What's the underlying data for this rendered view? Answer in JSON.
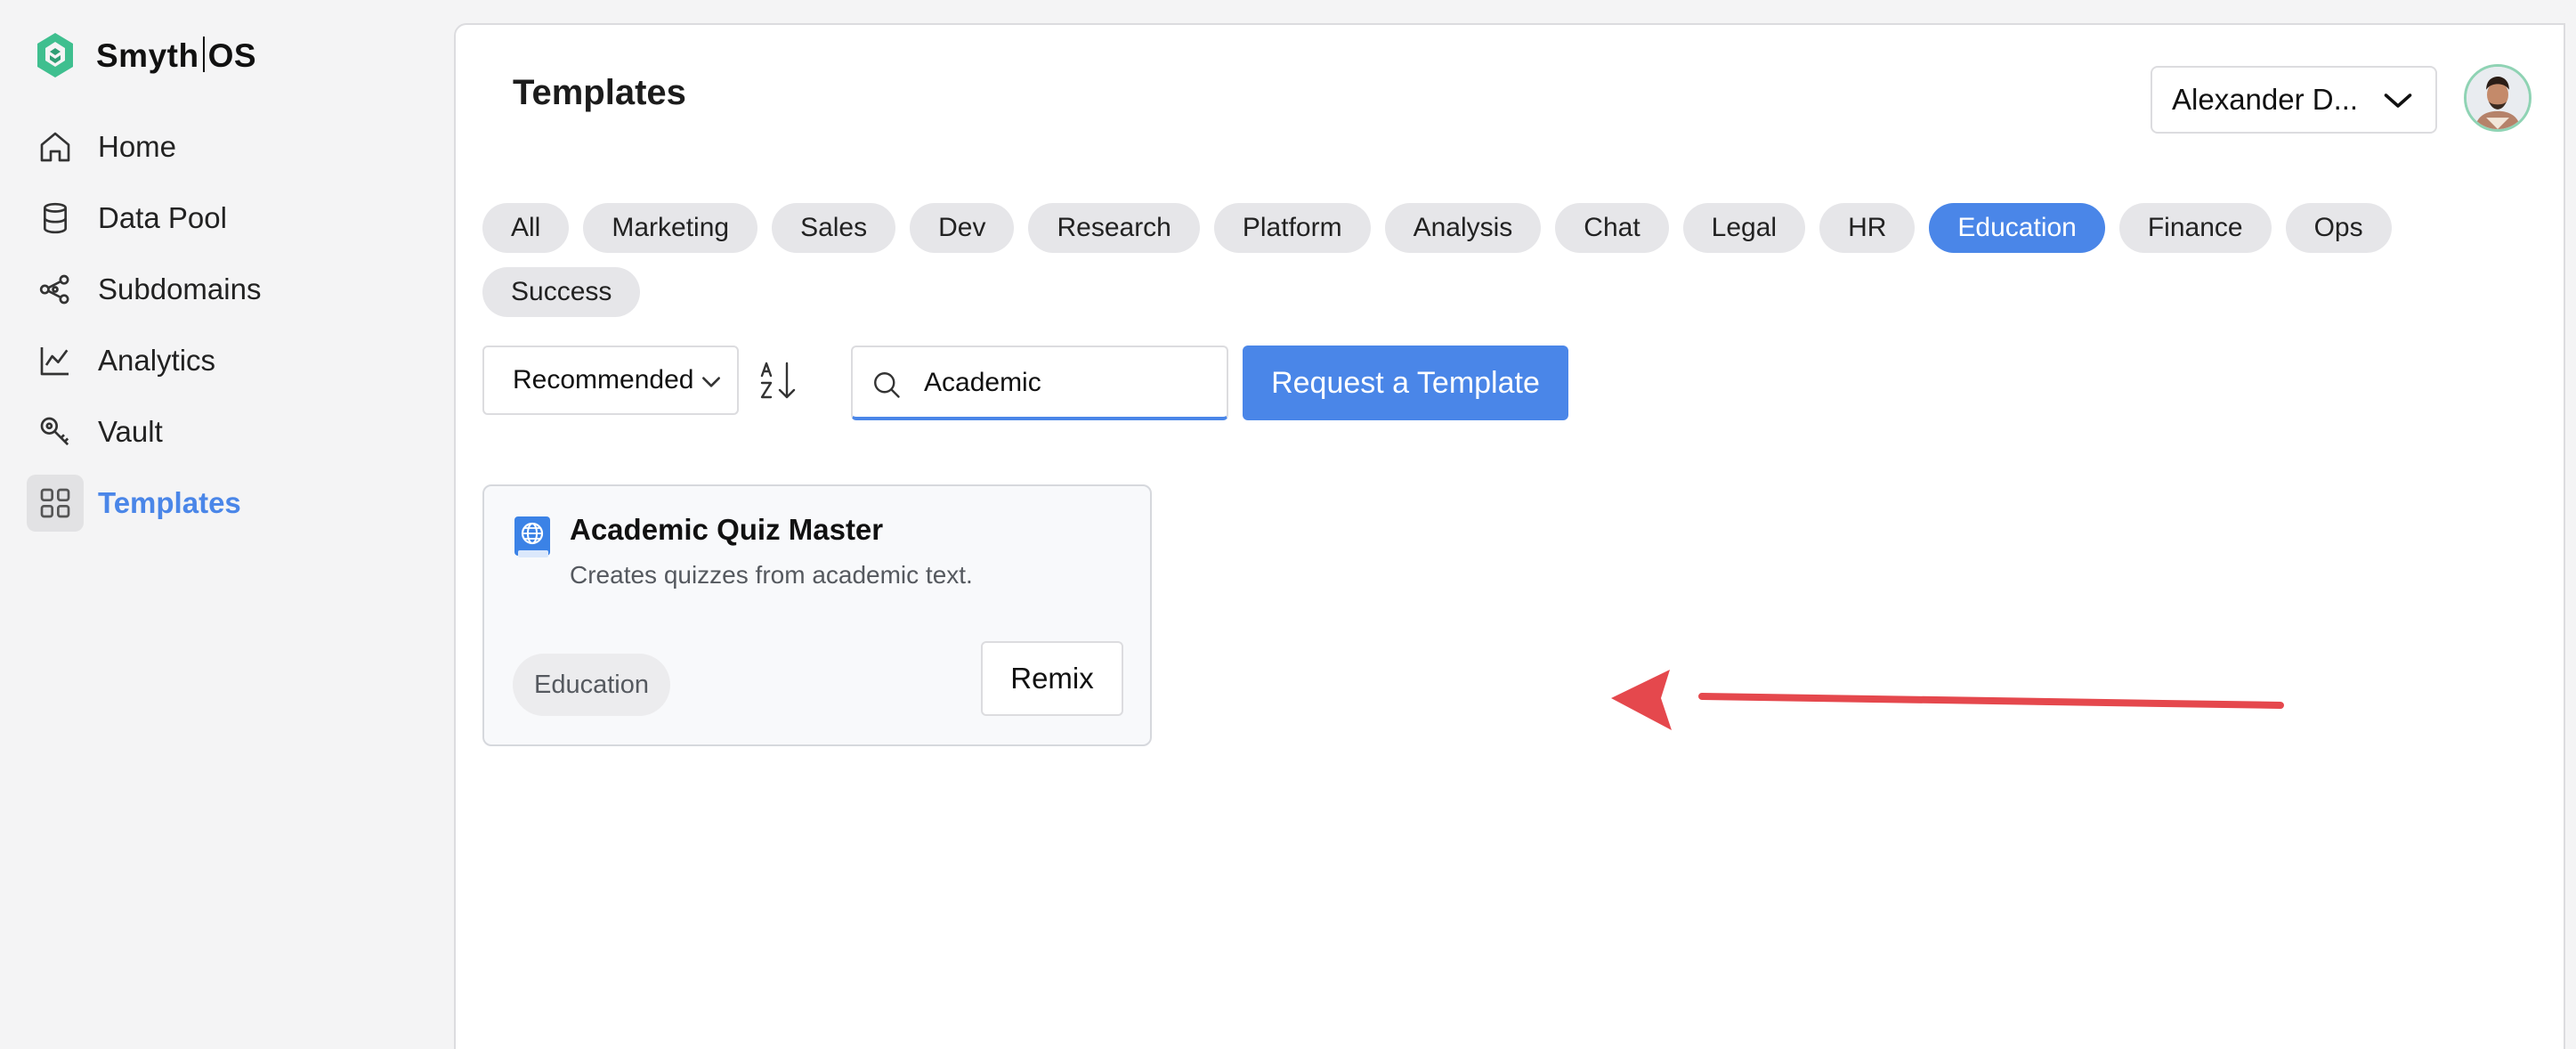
{
  "app": {
    "logo_left": "Smyth",
    "logo_right": "OS"
  },
  "sidebar": {
    "items": [
      {
        "label": "Home",
        "icon": "home-icon",
        "active": false
      },
      {
        "label": "Data Pool",
        "icon": "database-icon",
        "active": false
      },
      {
        "label": "Subdomains",
        "icon": "share-nodes-icon",
        "active": false
      },
      {
        "label": "Analytics",
        "icon": "chart-line-icon",
        "active": false
      },
      {
        "label": "Vault",
        "icon": "key-icon",
        "active": false
      },
      {
        "label": "Templates",
        "icon": "grid-icon",
        "active": true
      }
    ]
  },
  "header": {
    "title": "Templates",
    "user_name": "Alexander D...",
    "avatar_icon": "avatar"
  },
  "categories": [
    {
      "label": "All",
      "active": false
    },
    {
      "label": "Marketing",
      "active": false
    },
    {
      "label": "Sales",
      "active": false
    },
    {
      "label": "Dev",
      "active": false
    },
    {
      "label": "Research",
      "active": false
    },
    {
      "label": "Platform",
      "active": false
    },
    {
      "label": "Analysis",
      "active": false
    },
    {
      "label": "Chat",
      "active": false
    },
    {
      "label": "Legal",
      "active": false
    },
    {
      "label": "HR",
      "active": false
    },
    {
      "label": "Education",
      "active": true
    },
    {
      "label": "Finance",
      "active": false
    },
    {
      "label": "Ops",
      "active": false
    },
    {
      "label": "Success",
      "active": false
    }
  ],
  "toolbar": {
    "sort_value": "Recommended",
    "search_value": "Academic",
    "request_label": "Request a Template"
  },
  "templates": [
    {
      "title": "Academic Quiz Master",
      "description": "Creates quizzes from academic text.",
      "tag": "Education",
      "action_label": "Remix",
      "icon": "globe-book-icon"
    }
  ],
  "colors": {
    "accent": "#4a86e8",
    "annotation_arrow": "#e5484d"
  }
}
